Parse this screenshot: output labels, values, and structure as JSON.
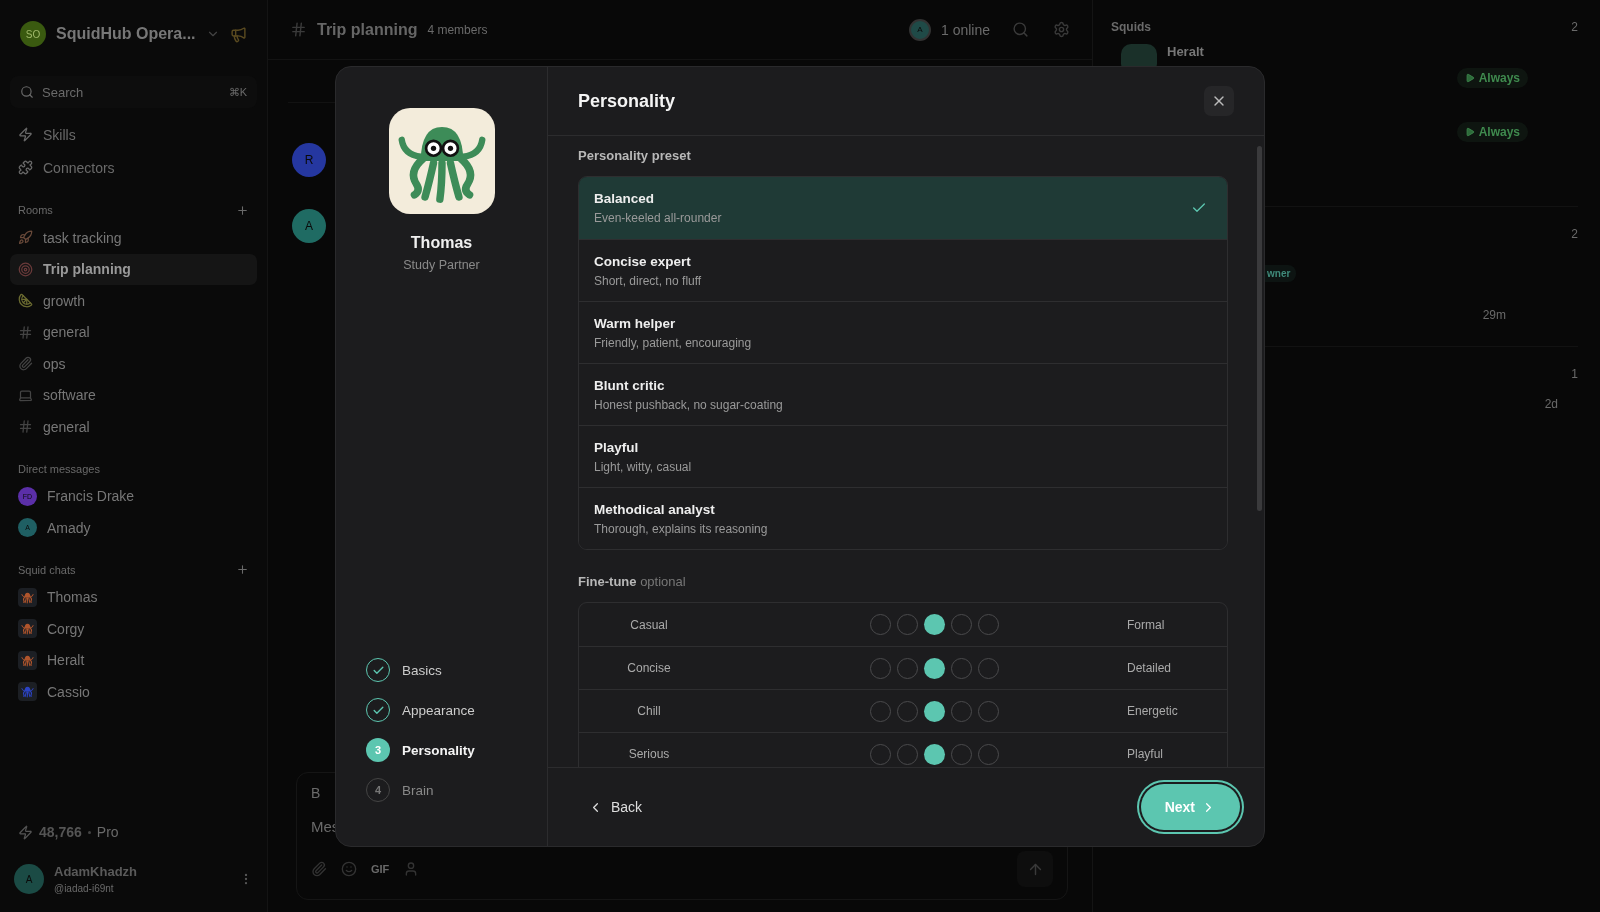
{
  "workspace": {
    "initials": "SO",
    "name": "SquidHub Opera..."
  },
  "search": {
    "placeholder": "Search",
    "shortcut": "⌘K"
  },
  "nav": [
    "Skills",
    "Connectors"
  ],
  "rooms": {
    "title": "Rooms",
    "items": [
      {
        "name": "task tracking",
        "selected": false
      },
      {
        "name": "Trip planning",
        "selected": true
      },
      {
        "name": "growth",
        "selected": false
      },
      {
        "name": "general",
        "selected": false
      },
      {
        "name": "ops",
        "selected": false
      },
      {
        "name": "software",
        "selected": false
      },
      {
        "name": "general",
        "selected": false
      }
    ]
  },
  "direct_messages": {
    "title": "Direct messages",
    "items": [
      {
        "initials": "FD",
        "name": "Francis Drake",
        "color": "#5b2fa8"
      },
      {
        "initials": "A",
        "name": "Amady",
        "color": "#1f5f63"
      }
    ]
  },
  "squid_chats": {
    "title": "Squid chats",
    "items": [
      {
        "name": "Thomas",
        "color": "#b0552c"
      },
      {
        "name": "Corgy",
        "color": "#b0552c"
      },
      {
        "name": "Heralt",
        "color": "#b0552c"
      },
      {
        "name": "Cassio",
        "color": "#2b43c4"
      }
    ]
  },
  "credits": {
    "amount": "48,766",
    "plan": "Pro"
  },
  "user": {
    "initials": "A",
    "name": "AdamKhadzh",
    "handle": "@iadad-i69nt"
  },
  "channel": {
    "name": "Trip planning",
    "members": "4 members",
    "online_avatar": "A",
    "online": "1 online"
  },
  "messages": [
    {
      "initials": "R",
      "color": "#2537a0"
    },
    {
      "initials": "A",
      "color": "#1f6b63"
    }
  ],
  "composer": {
    "format": "B",
    "placeholder": "Mes",
    "gif": "GIF"
  },
  "right_panel": {
    "title": "Squids",
    "count": "2",
    "squid": "Heralt",
    "badges": [
      "Always",
      "Always"
    ],
    "section_2_count": "2",
    "role_badge": "wner",
    "time_1": "29m",
    "section_3_count": "1",
    "time_2": "2d"
  },
  "modal": {
    "agent": {
      "name": "Thomas",
      "role": "Study Partner"
    },
    "steps": [
      {
        "label": "Basics",
        "done": true,
        "selected": false
      },
      {
        "label": "Appearance",
        "done": true,
        "selected": false
      },
      {
        "label": "Personality",
        "number": "3",
        "done": false,
        "selected": true
      },
      {
        "label": "Brain",
        "number": "4",
        "done": false,
        "selected": false
      }
    ],
    "title": "Personality",
    "preset_label": "Personality preset",
    "presets": [
      {
        "name": "Balanced",
        "description": "Even-keeled all-rounder",
        "selected": true
      },
      {
        "name": "Concise expert",
        "description": "Short, direct, no fluff",
        "selected": false
      },
      {
        "name": "Warm helper",
        "description": "Friendly, patient, encouraging",
        "selected": false
      },
      {
        "name": "Blunt critic",
        "description": "Honest pushback, no sugar-coating",
        "selected": false
      },
      {
        "name": "Playful",
        "description": "Light, witty, casual",
        "selected": false
      },
      {
        "name": "Methodical analyst",
        "description": "Thorough, explains its reasoning",
        "selected": false
      }
    ],
    "fine_tune": {
      "label": "Fine-tune",
      "hint": "optional"
    },
    "sliders": [
      {
        "left": "Casual",
        "right": "Formal",
        "level": 0.5
      },
      {
        "left": "Concise",
        "right": "Detailed",
        "level": 0.5
      },
      {
        "left": "Chill",
        "right": "Energetic",
        "level": 0.5
      },
      {
        "left": "Serious",
        "right": "Playful",
        "level": 0.5
      }
    ],
    "back": "Back",
    "next": "Next"
  }
}
